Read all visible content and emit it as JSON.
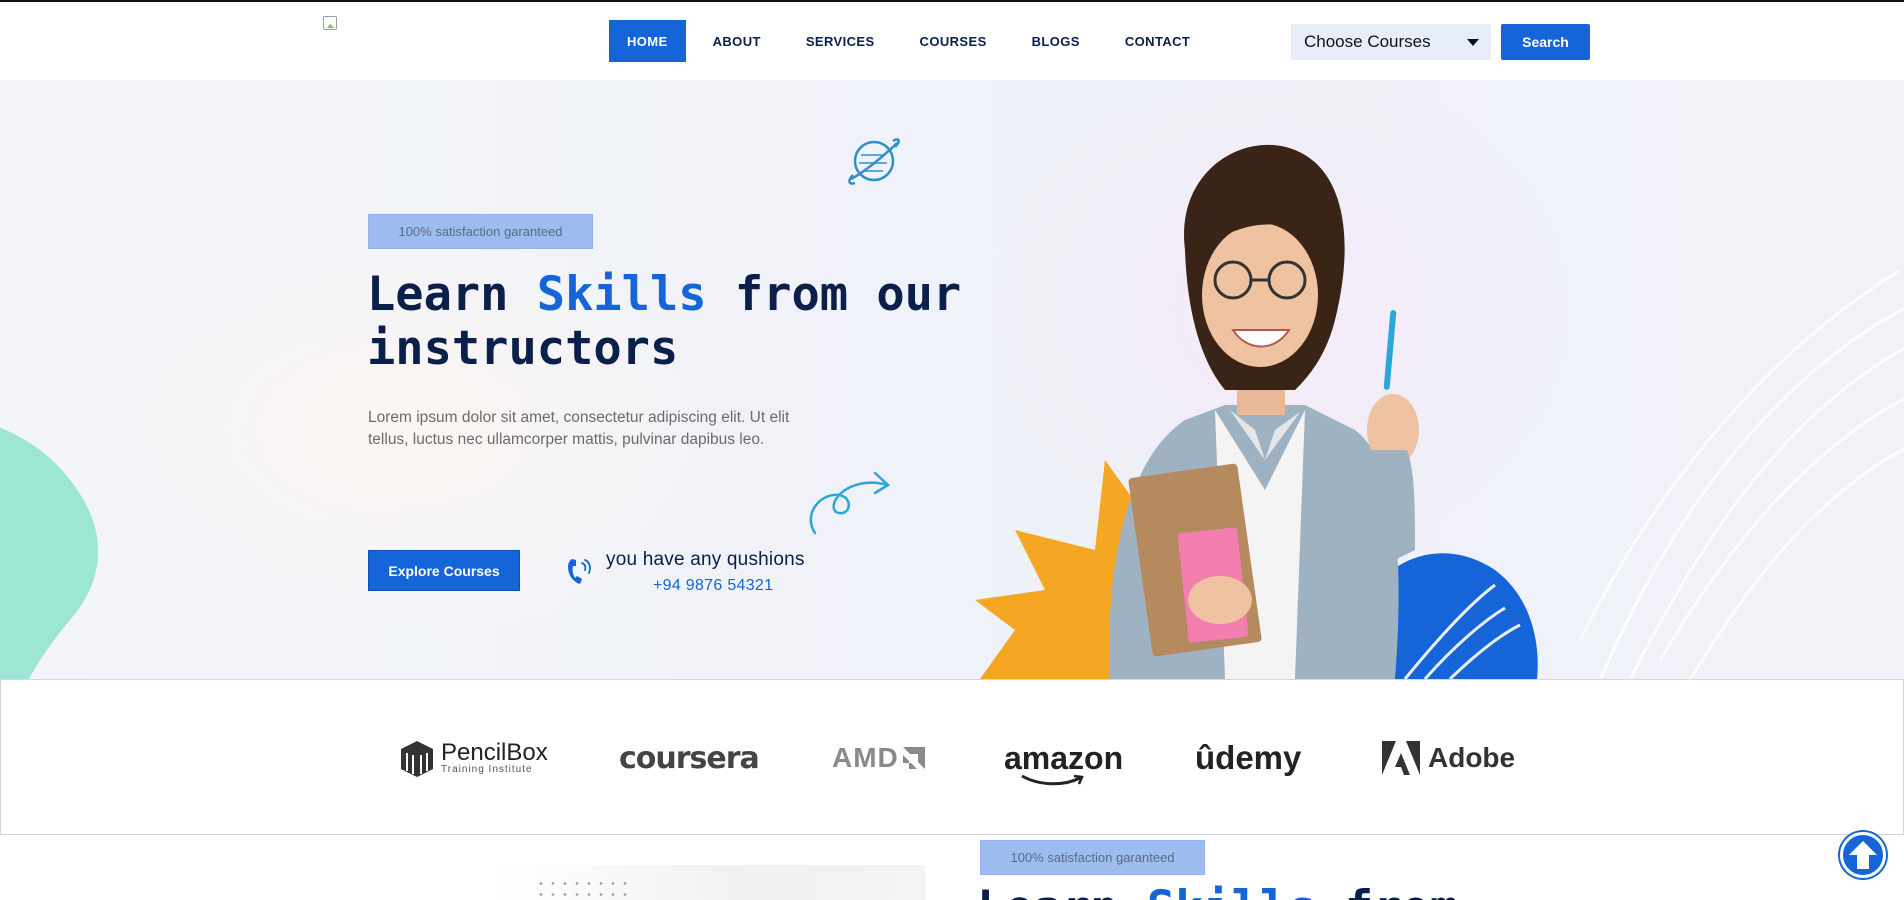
{
  "header": {
    "logo_alt": "",
    "nav": [
      {
        "label": "HOME",
        "active": true
      },
      {
        "label": "ABOUT",
        "active": false
      },
      {
        "label": "SERVICES",
        "active": false
      },
      {
        "label": "COURSES",
        "active": false
      },
      {
        "label": "BLOGS",
        "active": false
      },
      {
        "label": "CONTACT",
        "active": false
      }
    ],
    "course_select": "Choose Courses",
    "search_label": "Search"
  },
  "hero": {
    "badge": "100% satisfaction garanteed",
    "title_part1": "Learn ",
    "title_highlight": "Skills",
    "title_part2": " from our instructors",
    "description": "Lorem ipsum dolor sit amet, consectetur adipiscing elit. Ut elit tellus, luctus nec ullamcorper mattis, pulvinar dapibus leo.",
    "cta_label": "Explore Courses",
    "question": "you have any qushions",
    "phone": "+94 9876 54321"
  },
  "partners": {
    "pencilbox_name": "PencilBox",
    "pencilbox_sub": "Training Institute",
    "coursera": "coursera",
    "amd": "AMD",
    "amazon": "amazon",
    "udemy": "ûdemy",
    "adobe": "Adobe"
  },
  "next_section": {
    "badge": "100% satisfaction garanteed",
    "title_part1": "Learn ",
    "title_highlight": "Skills",
    "title_part2": " from"
  },
  "colors": {
    "primary": "#1565d8",
    "navy": "#0b1f4b",
    "badge_bg": "#9dbdf0",
    "accent_teal": "#9ee6d4",
    "accent_orange": "#f5a623"
  }
}
